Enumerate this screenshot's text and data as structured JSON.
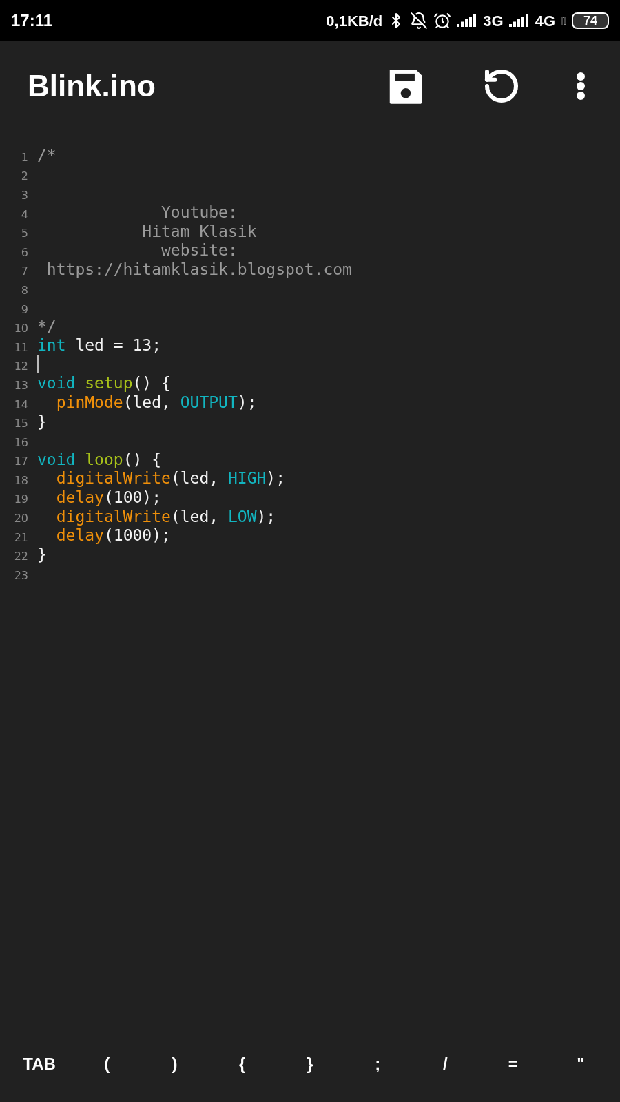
{
  "status_bar": {
    "time": "17:11",
    "speed": "0,1KB/d",
    "network_1": "3G",
    "network_2": "4G",
    "battery": "74"
  },
  "app_bar": {
    "title": "Blink.ino"
  },
  "editor": {
    "lines": [
      {
        "number": "1",
        "cursor": false,
        "tokens": [
          {
            "kind": "comment",
            "text": "/*"
          }
        ]
      },
      {
        "number": "2",
        "cursor": false
      },
      {
        "number": "3",
        "cursor": false
      },
      {
        "number": "4",
        "cursor": false,
        "tokens": [
          {
            "kind": "comment",
            "text": "             Youtube:"
          }
        ]
      },
      {
        "number": "5",
        "cursor": false,
        "tokens": [
          {
            "kind": "comment",
            "text": "           Hitam Klasik"
          }
        ]
      },
      {
        "number": "6",
        "cursor": false,
        "tokens": [
          {
            "kind": "comment",
            "text": "             website:"
          }
        ]
      },
      {
        "number": "7",
        "cursor": false,
        "tokens": [
          {
            "kind": "comment",
            "text": " https://hitamklasik.blogspot.com"
          }
        ]
      },
      {
        "number": "8",
        "cursor": false
      },
      {
        "number": "9",
        "cursor": false
      },
      {
        "number": "10",
        "cursor": false,
        "tokens": [
          {
            "kind": "comment",
            "text": "*/"
          }
        ]
      },
      {
        "number": "11",
        "cursor": false,
        "tokens": [
          {
            "kind": "type",
            "text": "int"
          },
          {
            "kind": "plain",
            "text": " led = 13;"
          }
        ]
      },
      {
        "number": "12",
        "cursor": true
      },
      {
        "number": "13",
        "cursor": false,
        "tokens": [
          {
            "kind": "type",
            "text": "void"
          },
          {
            "kind": "function",
            "text": " setup"
          },
          {
            "kind": "plain",
            "text": "() {"
          }
        ]
      },
      {
        "number": "14",
        "cursor": false,
        "tokens": [
          {
            "kind": "builtin",
            "text": "  pinMode"
          },
          {
            "kind": "plain",
            "text": "(led, "
          },
          {
            "kind": "constant",
            "text": "OUTPUT"
          },
          {
            "kind": "plain",
            "text": ");"
          }
        ]
      },
      {
        "number": "15",
        "cursor": false,
        "tokens": [
          {
            "kind": "plain",
            "text": "}"
          }
        ]
      },
      {
        "number": "16",
        "cursor": false
      },
      {
        "number": "17",
        "cursor": false,
        "tokens": [
          {
            "kind": "type",
            "text": "void"
          },
          {
            "kind": "function",
            "text": " loop"
          },
          {
            "kind": "plain",
            "text": "() {"
          }
        ]
      },
      {
        "number": "18",
        "cursor": false,
        "tokens": [
          {
            "kind": "builtin",
            "text": "  digitalWrite"
          },
          {
            "kind": "plain",
            "text": "(led, "
          },
          {
            "kind": "constant",
            "text": "HIGH"
          },
          {
            "kind": "plain",
            "text": ");"
          }
        ]
      },
      {
        "number": "19",
        "cursor": false,
        "tokens": [
          {
            "kind": "builtin",
            "text": "  delay"
          },
          {
            "kind": "plain",
            "text": "(100);"
          }
        ]
      },
      {
        "number": "20",
        "cursor": false,
        "tokens": [
          {
            "kind": "builtin",
            "text": "  digitalWrite"
          },
          {
            "kind": "plain",
            "text": "(led, "
          },
          {
            "kind": "constant",
            "text": "LOW"
          },
          {
            "kind": "plain",
            "text": ");"
          }
        ]
      },
      {
        "number": "21",
        "cursor": false,
        "tokens": [
          {
            "kind": "builtin",
            "text": "  delay"
          },
          {
            "kind": "plain",
            "text": "(1000);"
          }
        ]
      },
      {
        "number": "22",
        "cursor": false,
        "tokens": [
          {
            "kind": "plain",
            "text": "}"
          }
        ]
      },
      {
        "number": "23",
        "cursor": false
      }
    ]
  },
  "key_bar": [
    "TAB",
    "(",
    ")",
    "{",
    "}",
    ";",
    "/",
    "=",
    "\""
  ]
}
